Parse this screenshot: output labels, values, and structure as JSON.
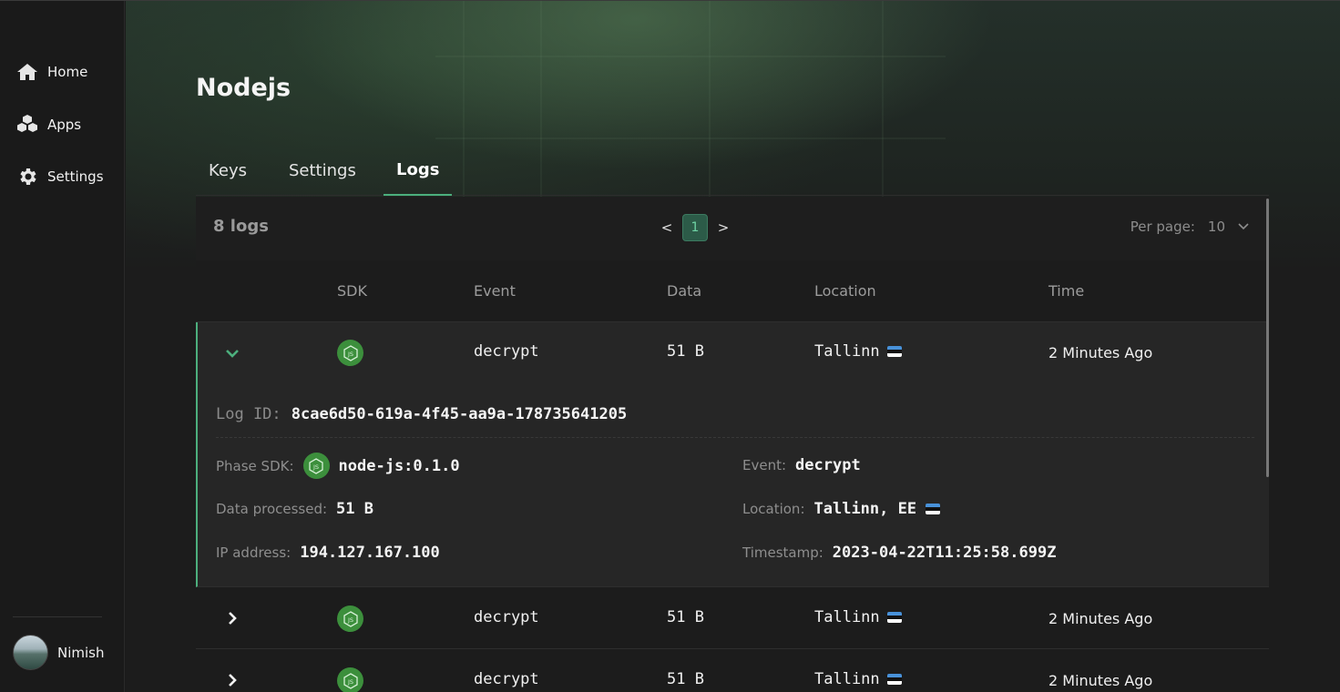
{
  "sidebar": {
    "items": [
      {
        "label": "Home",
        "icon": "home-icon"
      },
      {
        "label": "Apps",
        "icon": "cubes-icon"
      },
      {
        "label": "Settings",
        "icon": "gear-icon"
      }
    ],
    "user": {
      "name": "Nimish"
    }
  },
  "page": {
    "title": "Nodejs"
  },
  "tabs": [
    {
      "label": "Keys",
      "active": false
    },
    {
      "label": "Settings",
      "active": false
    },
    {
      "label": "Logs",
      "active": true
    }
  ],
  "logs": {
    "count_label": "8 logs",
    "pager": {
      "prev": "<",
      "page": "1",
      "next": ">"
    },
    "per_page": {
      "label": "Per page:",
      "value": "10"
    },
    "columns": [
      "SDK",
      "Event",
      "Data",
      "Location",
      "Time"
    ],
    "rows": [
      {
        "event": "decrypt",
        "data": "51 B",
        "location": "Tallinn",
        "time": "2 Minutes Ago",
        "expanded": true
      },
      {
        "event": "decrypt",
        "data": "51 B",
        "location": "Tallinn",
        "time": "2 Minutes Ago",
        "expanded": false
      },
      {
        "event": "decrypt",
        "data": "51 B",
        "location": "Tallinn",
        "time": "2 Minutes Ago",
        "expanded": false
      }
    ],
    "detail": {
      "log_id_label": "Log ID:",
      "log_id": "8cae6d50-619a-4f45-aa9a-178735641205",
      "phase_sdk_label": "Phase SDK:",
      "phase_sdk": "node-js:0.1.0",
      "event_label": "Event:",
      "event": "decrypt",
      "data_label": "Data processed:",
      "data": "51 B",
      "location_label": "Location:",
      "location": "Tallinn, EE",
      "ip_label": "IP address:",
      "ip": "194.127.167.100",
      "timestamp_label": "Timestamp:",
      "timestamp": "2023-04-22T11:25:58.699Z"
    }
  },
  "colors": {
    "accent": "#4caf7d",
    "node_green": "#3c8f3c",
    "flag_blue": "#4891d9"
  }
}
